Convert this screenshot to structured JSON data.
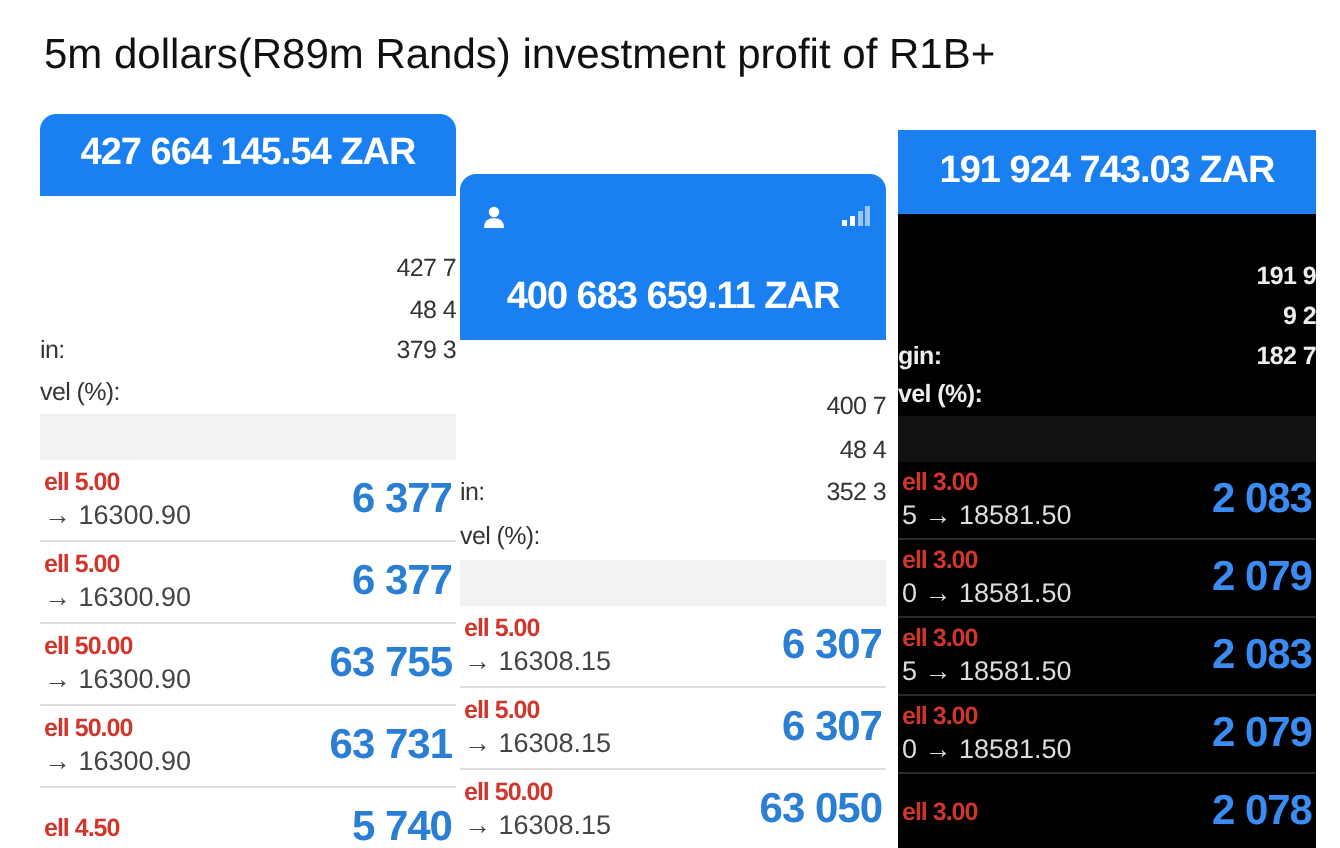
{
  "caption": "5m dollars(R89m Rands) investment profit of R1B+",
  "screens": [
    {
      "dark": false,
      "status_bar": false,
      "balance": "427 664 145.54 ZAR",
      "stat_values": [
        "427 7",
        "48 4",
        "379 3"
      ],
      "stat_labels": [
        "in:",
        "vel (%):"
      ],
      "positions": [
        {
          "trade": "ell 5.00",
          "price": "→ 16300.90",
          "profit": "6 377"
        },
        {
          "trade": "ell 5.00",
          "price": "→ 16300.90",
          "profit": "6 377"
        },
        {
          "trade": "ell 50.00",
          "price": "→ 16300.90",
          "profit": "63 755"
        },
        {
          "trade": "ell 50.00",
          "price": "→ 16300.90",
          "profit": "63 731"
        },
        {
          "trade": "ell 4.50",
          "profit": "5 740"
        }
      ]
    },
    {
      "dark": false,
      "status_bar": true,
      "balance": "400 683 659.11 ZAR",
      "stat_values": [
        "400 7",
        "48 4",
        "352 3"
      ],
      "stat_labels": [
        "in:",
        "vel (%):"
      ],
      "positions": [
        {
          "trade": "ell 5.00",
          "price": "→ 16308.15",
          "profit": "6 307"
        },
        {
          "trade": "ell 5.00",
          "price": "→ 16308.15",
          "profit": "6 307"
        },
        {
          "trade": "ell 50.00",
          "price": "→ 16308.15",
          "profit": "63 050"
        }
      ]
    },
    {
      "dark": true,
      "status_bar": false,
      "balance": "191 924 743.03 ZAR",
      "stat_values": [
        "191 9",
        "9 2",
        "182 7"
      ],
      "stat_labels": [
        "gin:",
        "vel (%):"
      ],
      "positions": [
        {
          "trade": "ell 3.00",
          "price": "5 → 18581.50",
          "profit": "2 083"
        },
        {
          "trade": "ell 3.00",
          "price": "0 → 18581.50",
          "profit": "2 079"
        },
        {
          "trade": "ell 3.00",
          "price": "5 → 18581.50",
          "profit": "2 083"
        },
        {
          "trade": "ell 3.00",
          "price": "0 → 18581.50",
          "profit": "2 079"
        },
        {
          "trade": "ell 3.00",
          "profit": "2 078"
        }
      ]
    }
  ]
}
